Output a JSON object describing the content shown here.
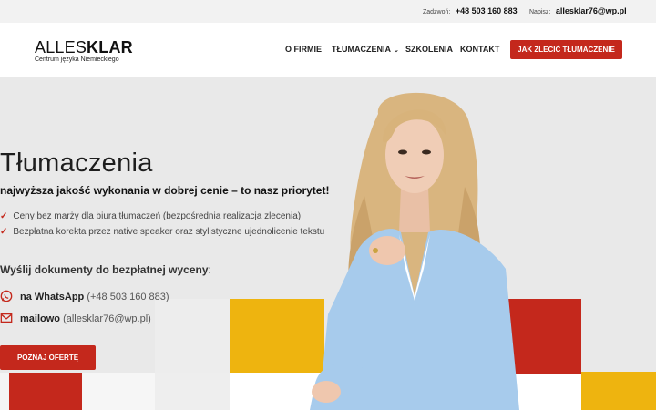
{
  "topbar": {
    "call_label": "Zadzwoń:",
    "call_value": "+48 503 160 883",
    "write_label": "Napisz:",
    "write_value": "allesklar76@wp.pl"
  },
  "logo": {
    "word_a": "ALLES",
    "word_b": "KLAR",
    "subtitle": "Centrum języka Niemieckiego"
  },
  "nav": {
    "items": [
      "O FIRMIE",
      "TŁUMACZENIA",
      "SZKOLENIA",
      "KONTAKT"
    ],
    "chevron": "⌄",
    "cta": "JAK ZLECIĆ TŁUMACZENIE"
  },
  "hero": {
    "title": "Tłumaczenia",
    "subtitle": "najwyższa jakość wykonania w dobrej cenie – to nasz priorytet!",
    "bullets": [
      "Ceny bez marży dla biura tłumaczeń (bezpośrednia realizacja zlecenia)",
      "Bezpłatna korekta przez native speaker oraz stylistyczne ujednolicenie tekstu"
    ],
    "send_title": "Wyślij dokumenty do bezpłatnej wyceny",
    "send_colon": ":",
    "whatsapp_strong": "na WhatsApp",
    "whatsapp_value": "(+48 503 160 883)",
    "mail_strong": "mailowo",
    "mail_value": "(allesklar76@wp.pl)",
    "offer_button": "POZNAJ OFERTĘ"
  },
  "colors": {
    "accent_red": "#c4281c",
    "accent_yellow": "#eeb40f",
    "icon": "whatsapp-icon, mail-icon, check-icon"
  }
}
